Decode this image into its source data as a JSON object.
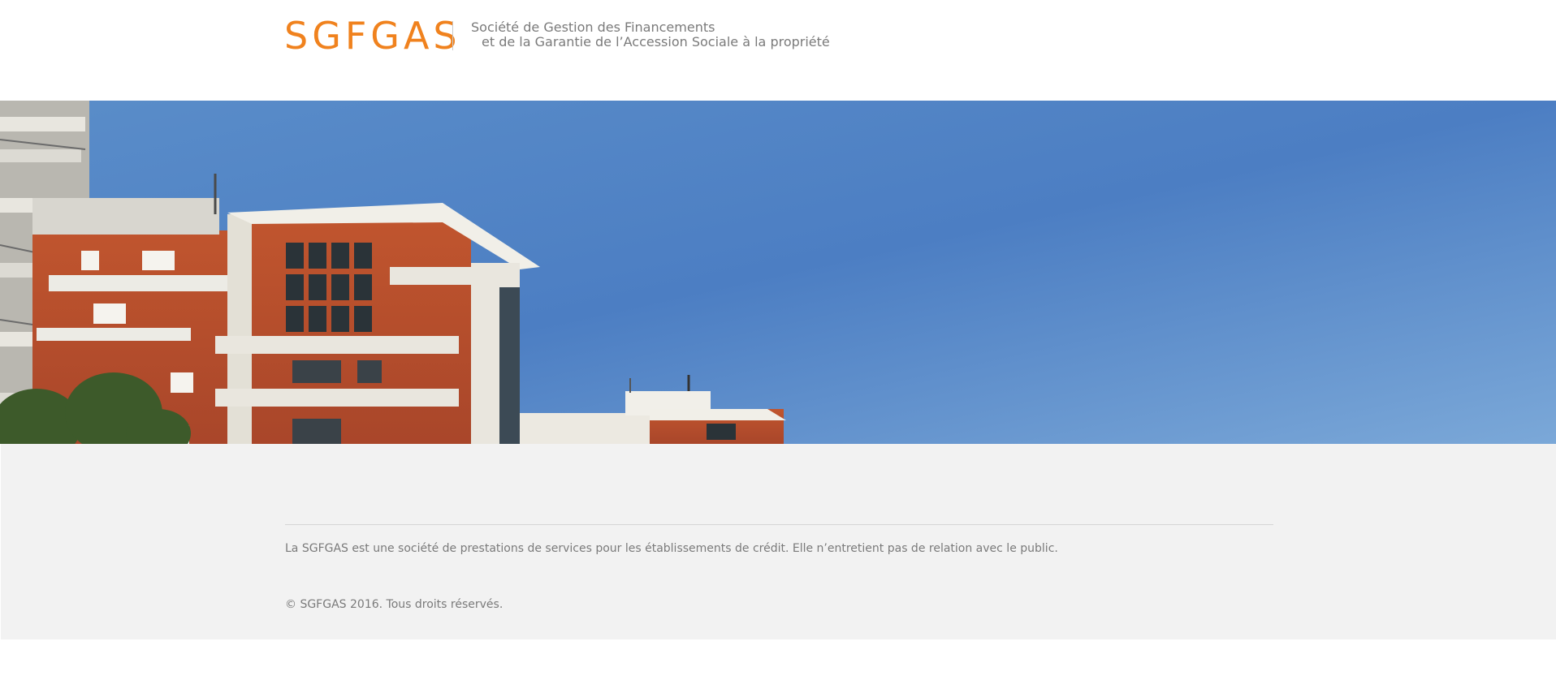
{
  "header": {
    "logo": "SGFGAS",
    "tagline_line1": "Société de Gestion des Financements",
    "tagline_line2": "et de la Garantie de l’Accession Sociale à la propriété"
  },
  "hero": {
    "image": "apartment-buildings-blue-sky-photo"
  },
  "footer": {
    "description": "La SGFGAS est une société de prestations de services pour les établissements de crédit. Elle n’entretient pas de relation avec le public.",
    "copyright": "© SGFGAS 2016. Tous droits réservés."
  },
  "colors": {
    "brand_orange": "#f0821e",
    "text_gray": "#7a7a7a",
    "footer_bg": "#f2f2f2",
    "sky_blue": "#4f82c6"
  }
}
